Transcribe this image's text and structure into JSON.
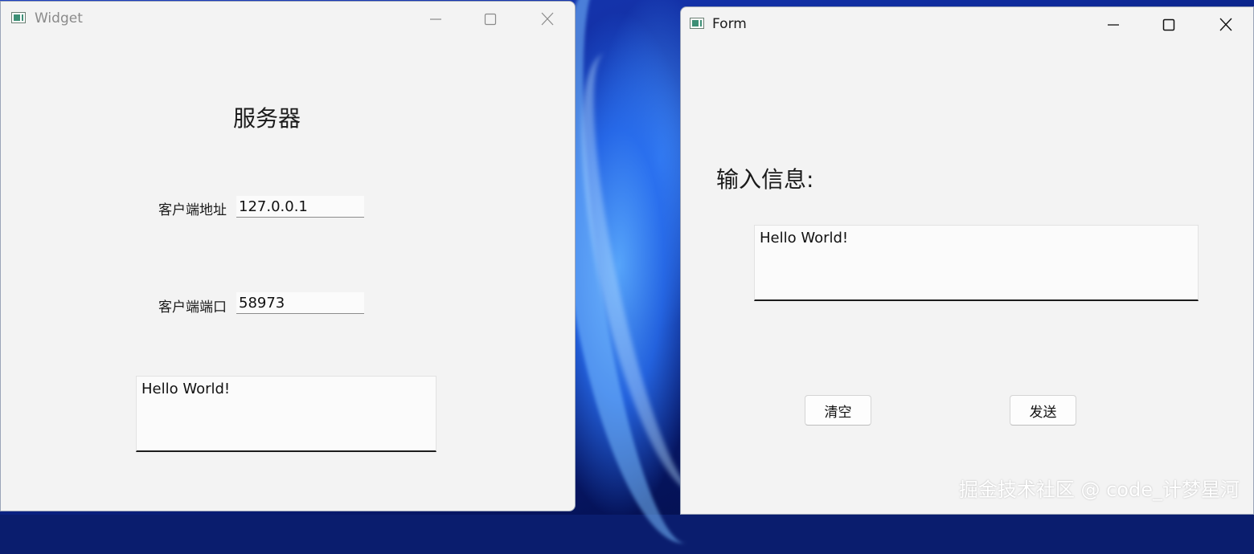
{
  "widget_window": {
    "title": "Widget",
    "heading": "服务器",
    "client_address_label": "客户端地址",
    "client_address_value": "127.0.0.1",
    "client_port_label": "客户端端口",
    "client_port_value": "58973",
    "message_text": "Hello World!"
  },
  "form_window": {
    "title": "Form",
    "input_label": "输入信息:",
    "message_text": "Hello World!",
    "clear_label": "清空",
    "send_label": "发送"
  },
  "watermark": "掘金技术社区 @ code_计梦星河",
  "icons": {
    "minimize": "minimize-icon",
    "maximize": "maximize-icon",
    "close": "close-icon",
    "app": "qt-app-icon"
  },
  "colors": {
    "window_bg": "#f3f3f3",
    "inactive_title_text": "#8a8a8a",
    "active_title_text": "#1a1a1a",
    "desktop_accent": "#1c3fc0"
  }
}
